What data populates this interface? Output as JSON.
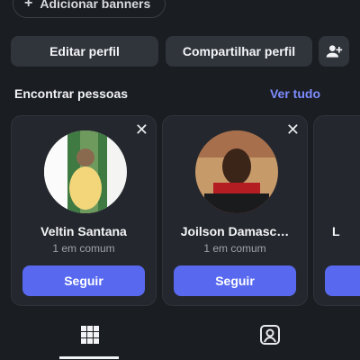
{
  "profile_actions": {
    "add_banners_label": "Adicionar banners",
    "edit_profile_label": "Editar perfil",
    "share_profile_label": "Compartilhar perfil",
    "add_person_icon": "person-add-icon"
  },
  "find_people": {
    "title": "Encontrar pessoas",
    "see_all_label": "Ver tudo",
    "cards": [
      {
        "name": "Veltin Santana",
        "mutual": "1 em comum",
        "follow_label": "Seguir"
      },
      {
        "name": "Joilson Damasc…",
        "mutual": "1 em comum",
        "follow_label": "Seguir"
      },
      {
        "name": "L"
      }
    ]
  },
  "tabs": [
    {
      "icon": "grid-icon",
      "selected": true
    },
    {
      "icon": "tagged-person-icon",
      "selected": false
    }
  ],
  "colors": {
    "background": "#1a1d22",
    "card": "#24272d",
    "button_dark": "#30343b",
    "accent": "#5869f0",
    "link": "#7e8cff"
  }
}
